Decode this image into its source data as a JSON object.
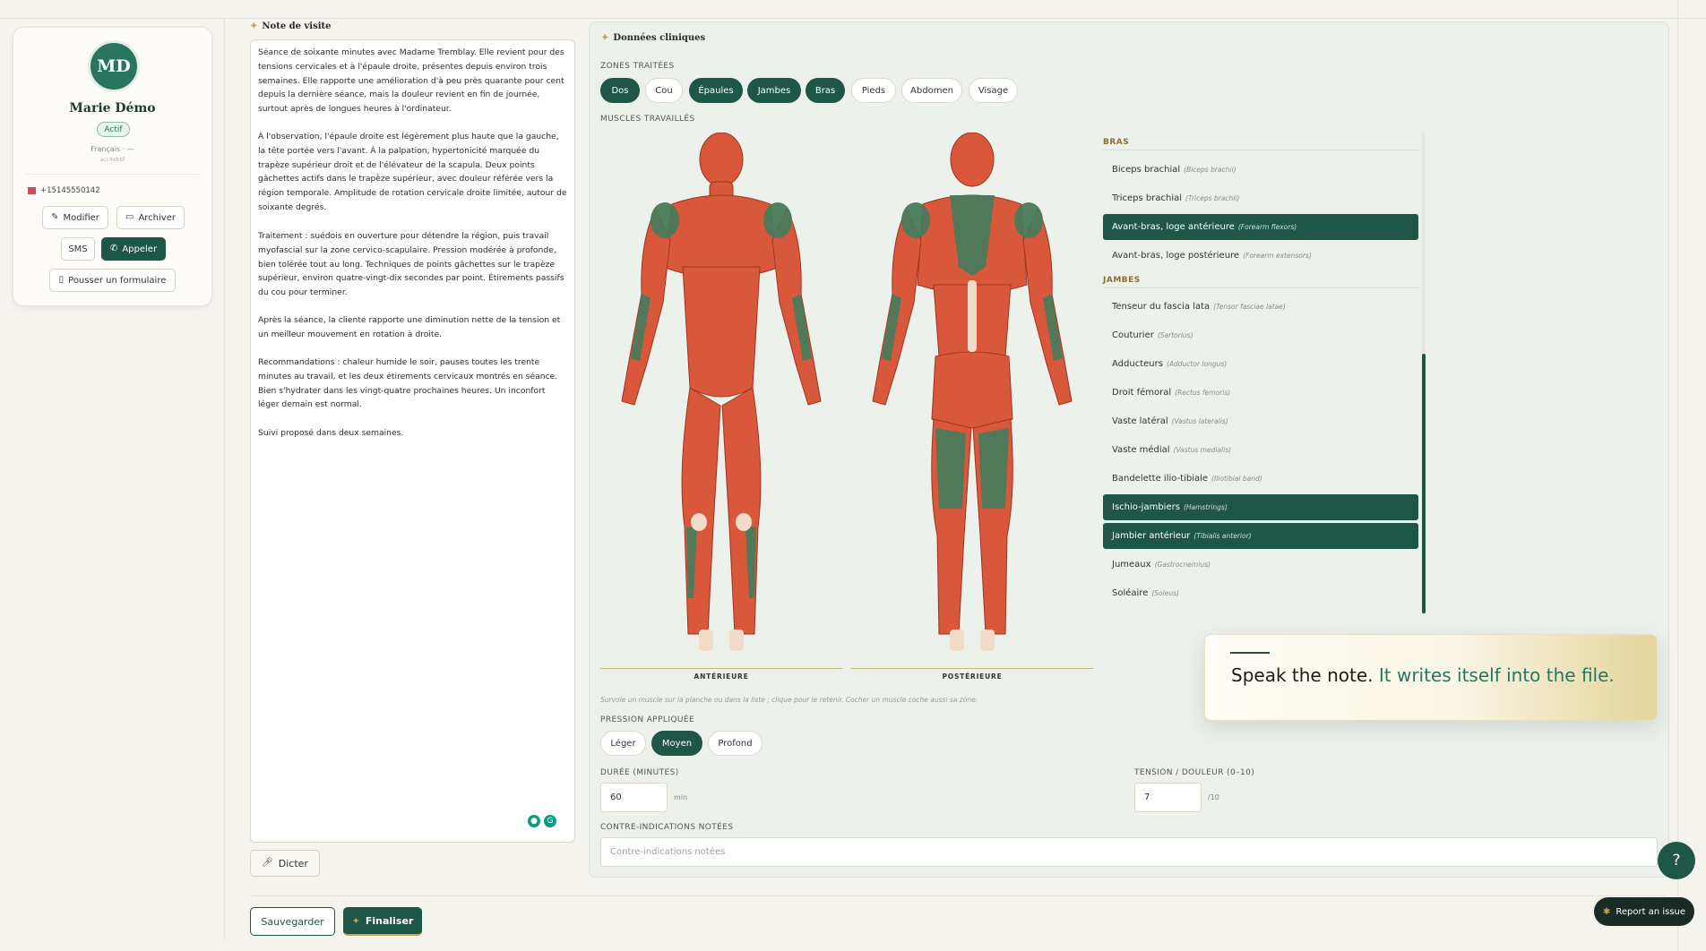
{
  "profile": {
    "initials": "MD",
    "name": "Marie Démo",
    "status": "Actif",
    "language": "Français · —",
    "id": "acc4eb6f",
    "phone": "+15145550142",
    "btn_edit": "Modifier",
    "btn_archive": "Archiver",
    "btn_sms": "SMS",
    "btn_call": "Appeler",
    "btn_form": "Pousser un formulaire"
  },
  "note": {
    "title": "Note de visite",
    "paragraphs": [
      "Séance de soixante minutes avec Madame Tremblay. Elle revient pour des tensions cervicales et à l'épaule droite, présentes depuis environ trois semaines. Elle rapporte une amélioration d'à peu près quarante pour cent depuis la dernière séance, mais la douleur revient en fin de journée, surtout après de longues heures à l'ordinateur.",
      "À l'observation, l'épaule droite est légèrement plus haute que la gauche, la tête portée vers l'avant. À la palpation, hypertonicité marquée du trapèze supérieur droit et de l'élévateur de la scapula. Deux points gâchettes actifs dans le trapèze supérieur, avec douleur référée vers la région temporale. Amplitude de rotation cervicale droite limitée, autour de soixante degrés.",
      "Traitement : suédois en ouverture pour détendre la région, puis travail myofascial sur la zone cervico-scapulaire. Pression modérée à profonde, bien tolérée tout au long. Techniques de points gâchettes sur le trapèze supérieur, environ quatre-vingt-dix secondes par point. Étirements passifs du cou pour terminer.",
      "Après la séance, la cliente rapporte une diminution nette de la tension et un meilleur mouvement en rotation à droite.",
      "Recommandations : chaleur humide le soir, pauses toutes les trente minutes au travail, et les deux étirements cervicaux montrés en séance. Bien s'hydrater dans les vingt-quatre prochaines heures. Un inconfort léger demain est normal.",
      "Suivi proposé dans deux semaines."
    ],
    "dictate": "Dicter",
    "save": "Sauvegarder",
    "finalize": "Finaliser"
  },
  "clinical": {
    "title": "Données cliniques",
    "zones_label": "ZONES TRAITÉES",
    "zones": [
      {
        "label": "Dos",
        "on": true
      },
      {
        "label": "Cou",
        "on": false
      },
      {
        "label": "Épaules",
        "on": true
      },
      {
        "label": "Jambes",
        "on": true
      },
      {
        "label": "Bras",
        "on": true
      },
      {
        "label": "Pieds",
        "on": false
      },
      {
        "label": "Abdomen",
        "on": false
      },
      {
        "label": "Visage",
        "on": false
      }
    ],
    "muscles_label": "MUSCLES TRAVAILLÉS",
    "view_front": "ANTÉRIEURE",
    "view_back": "POSTÉRIEURE",
    "hint": "Survole un muscle sur la planche ou dans la liste ; clique pour le retenir. Cocher un muscle coche aussi sa zone.",
    "groups": [
      {
        "name": "BRAS",
        "muscles": [
          {
            "name": "Biceps brachial",
            "latin": "(Biceps brachii)",
            "on": false
          },
          {
            "name": "Triceps brachial",
            "latin": "(Triceps brachii)",
            "on": false
          },
          {
            "name": "Avant-bras, loge antérieure",
            "latin": "(Forearm flexors)",
            "on": true
          },
          {
            "name": "Avant-bras, loge postérieure",
            "latin": "(Forearm extensors)",
            "on": false
          }
        ]
      },
      {
        "name": "JAMBES",
        "muscles": [
          {
            "name": "Tenseur du fascia lata",
            "latin": "(Tensor fasciae latae)",
            "on": false
          },
          {
            "name": "Couturier",
            "latin": "(Sartorius)",
            "on": false
          },
          {
            "name": "Adducteurs",
            "latin": "(Adductor longus)",
            "on": false
          },
          {
            "name": "Droit fémoral",
            "latin": "(Rectus femoris)",
            "on": false
          },
          {
            "name": "Vaste latéral",
            "latin": "(Vastus lateralis)",
            "on": false
          },
          {
            "name": "Vaste médial",
            "latin": "(Vastus medialis)",
            "on": false
          },
          {
            "name": "Bandelette ilio-tibiale",
            "latin": "(Iliotibial band)",
            "on": false
          },
          {
            "name": "Ischio-jambiers",
            "latin": "(Hamstrings)",
            "on": true
          },
          {
            "name": "Jambier antérieur",
            "latin": "(Tibialis anterior)",
            "on": true
          },
          {
            "name": "Jumeaux",
            "latin": "(Gastrocnemius)",
            "on": false
          },
          {
            "name": "Soléaire",
            "latin": "(Soleus)",
            "on": false
          }
        ]
      }
    ],
    "pressure_label": "PRESSION APPLIQUÉE",
    "pressure": [
      {
        "label": "Léger",
        "on": false
      },
      {
        "label": "Moyen",
        "on": true
      },
      {
        "label": "Profond",
        "on": false
      }
    ],
    "duration_label": "DURÉE (MINUTES)",
    "duration_value": "60",
    "duration_unit": "min",
    "tension_label": "TENSION / DOULEUR (0–10)",
    "tension_value": "7",
    "tension_unit": "/10",
    "contra_label": "CONTRE-INDICATIONS NOTÉES",
    "contra_placeholder": "Contre-indications notées"
  },
  "tooltip": {
    "text_a": "Speak the note.",
    "text_b": "It writes itself into the file."
  },
  "report": "Report an issue",
  "colors": {
    "accent": "#1e5647",
    "gold": "#c5a44f",
    "muscle": "#d9573a",
    "muscle_selected": "#4a7a5a"
  }
}
